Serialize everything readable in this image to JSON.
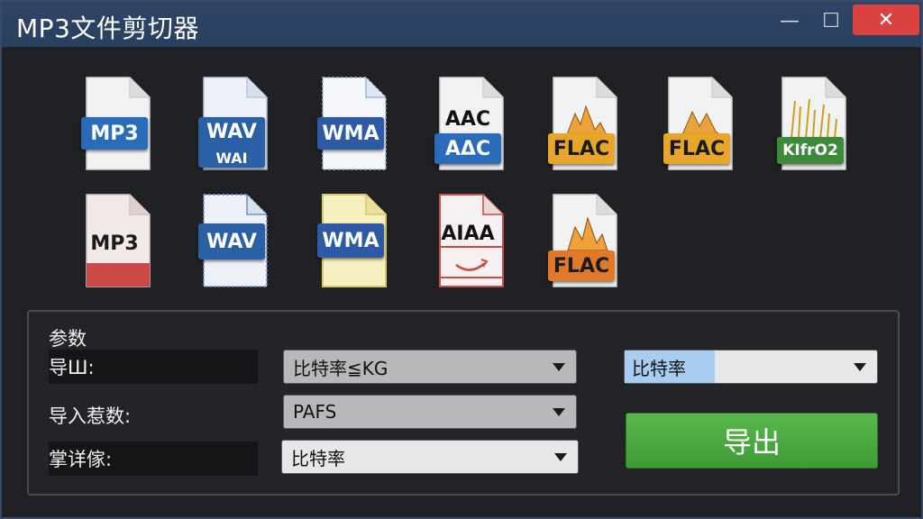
{
  "window": {
    "title": "MP3文件剪切器",
    "minimize_glyph": "—",
    "maximize_glyph": "☐",
    "close_glyph": "✕"
  },
  "file_icons": {
    "row1": [
      {
        "label": "MP3",
        "sublabel": "",
        "color": "#2b6cb8"
      },
      {
        "label": "WAV",
        "sublabel": "WAI",
        "color": "#2b5fa6"
      },
      {
        "label": "WMA",
        "sublabel": "",
        "color": "#2d5aa3"
      },
      {
        "label": "AAC",
        "sublabel": "AΔC",
        "color": "#2b6cb8"
      },
      {
        "label": "FLAC",
        "sublabel": "",
        "color": "#e7a52a"
      },
      {
        "label": "FLAC",
        "sublabel": "",
        "color": "#e7a52a"
      },
      {
        "label": "KIfrO2",
        "sublabel": "",
        "color": "#3d8a3a"
      }
    ],
    "row2": [
      {
        "label": "MP3",
        "sublabel": "",
        "color": "#c94a47"
      },
      {
        "label": "WAV",
        "sublabel": "",
        "color": "#2b5fa6"
      },
      {
        "label": "WMA",
        "sublabel": "",
        "color": "#2d5aa3"
      },
      {
        "label": "AIAA",
        "sublabel": "",
        "color": "#c94a47"
      },
      {
        "label": "FLAC",
        "sublabel": "",
        "color": "#e07a2a"
      }
    ]
  },
  "params": {
    "section_title": "参数",
    "label_1": "导Ш:",
    "label_2": "导入惹数:",
    "label_3": "掌详傢:",
    "select_1_value": "比特率≦KG",
    "select_2_value": "PAFS",
    "select_3_value": "比特率",
    "select_4_value": "比特率",
    "export_button": "导出"
  }
}
